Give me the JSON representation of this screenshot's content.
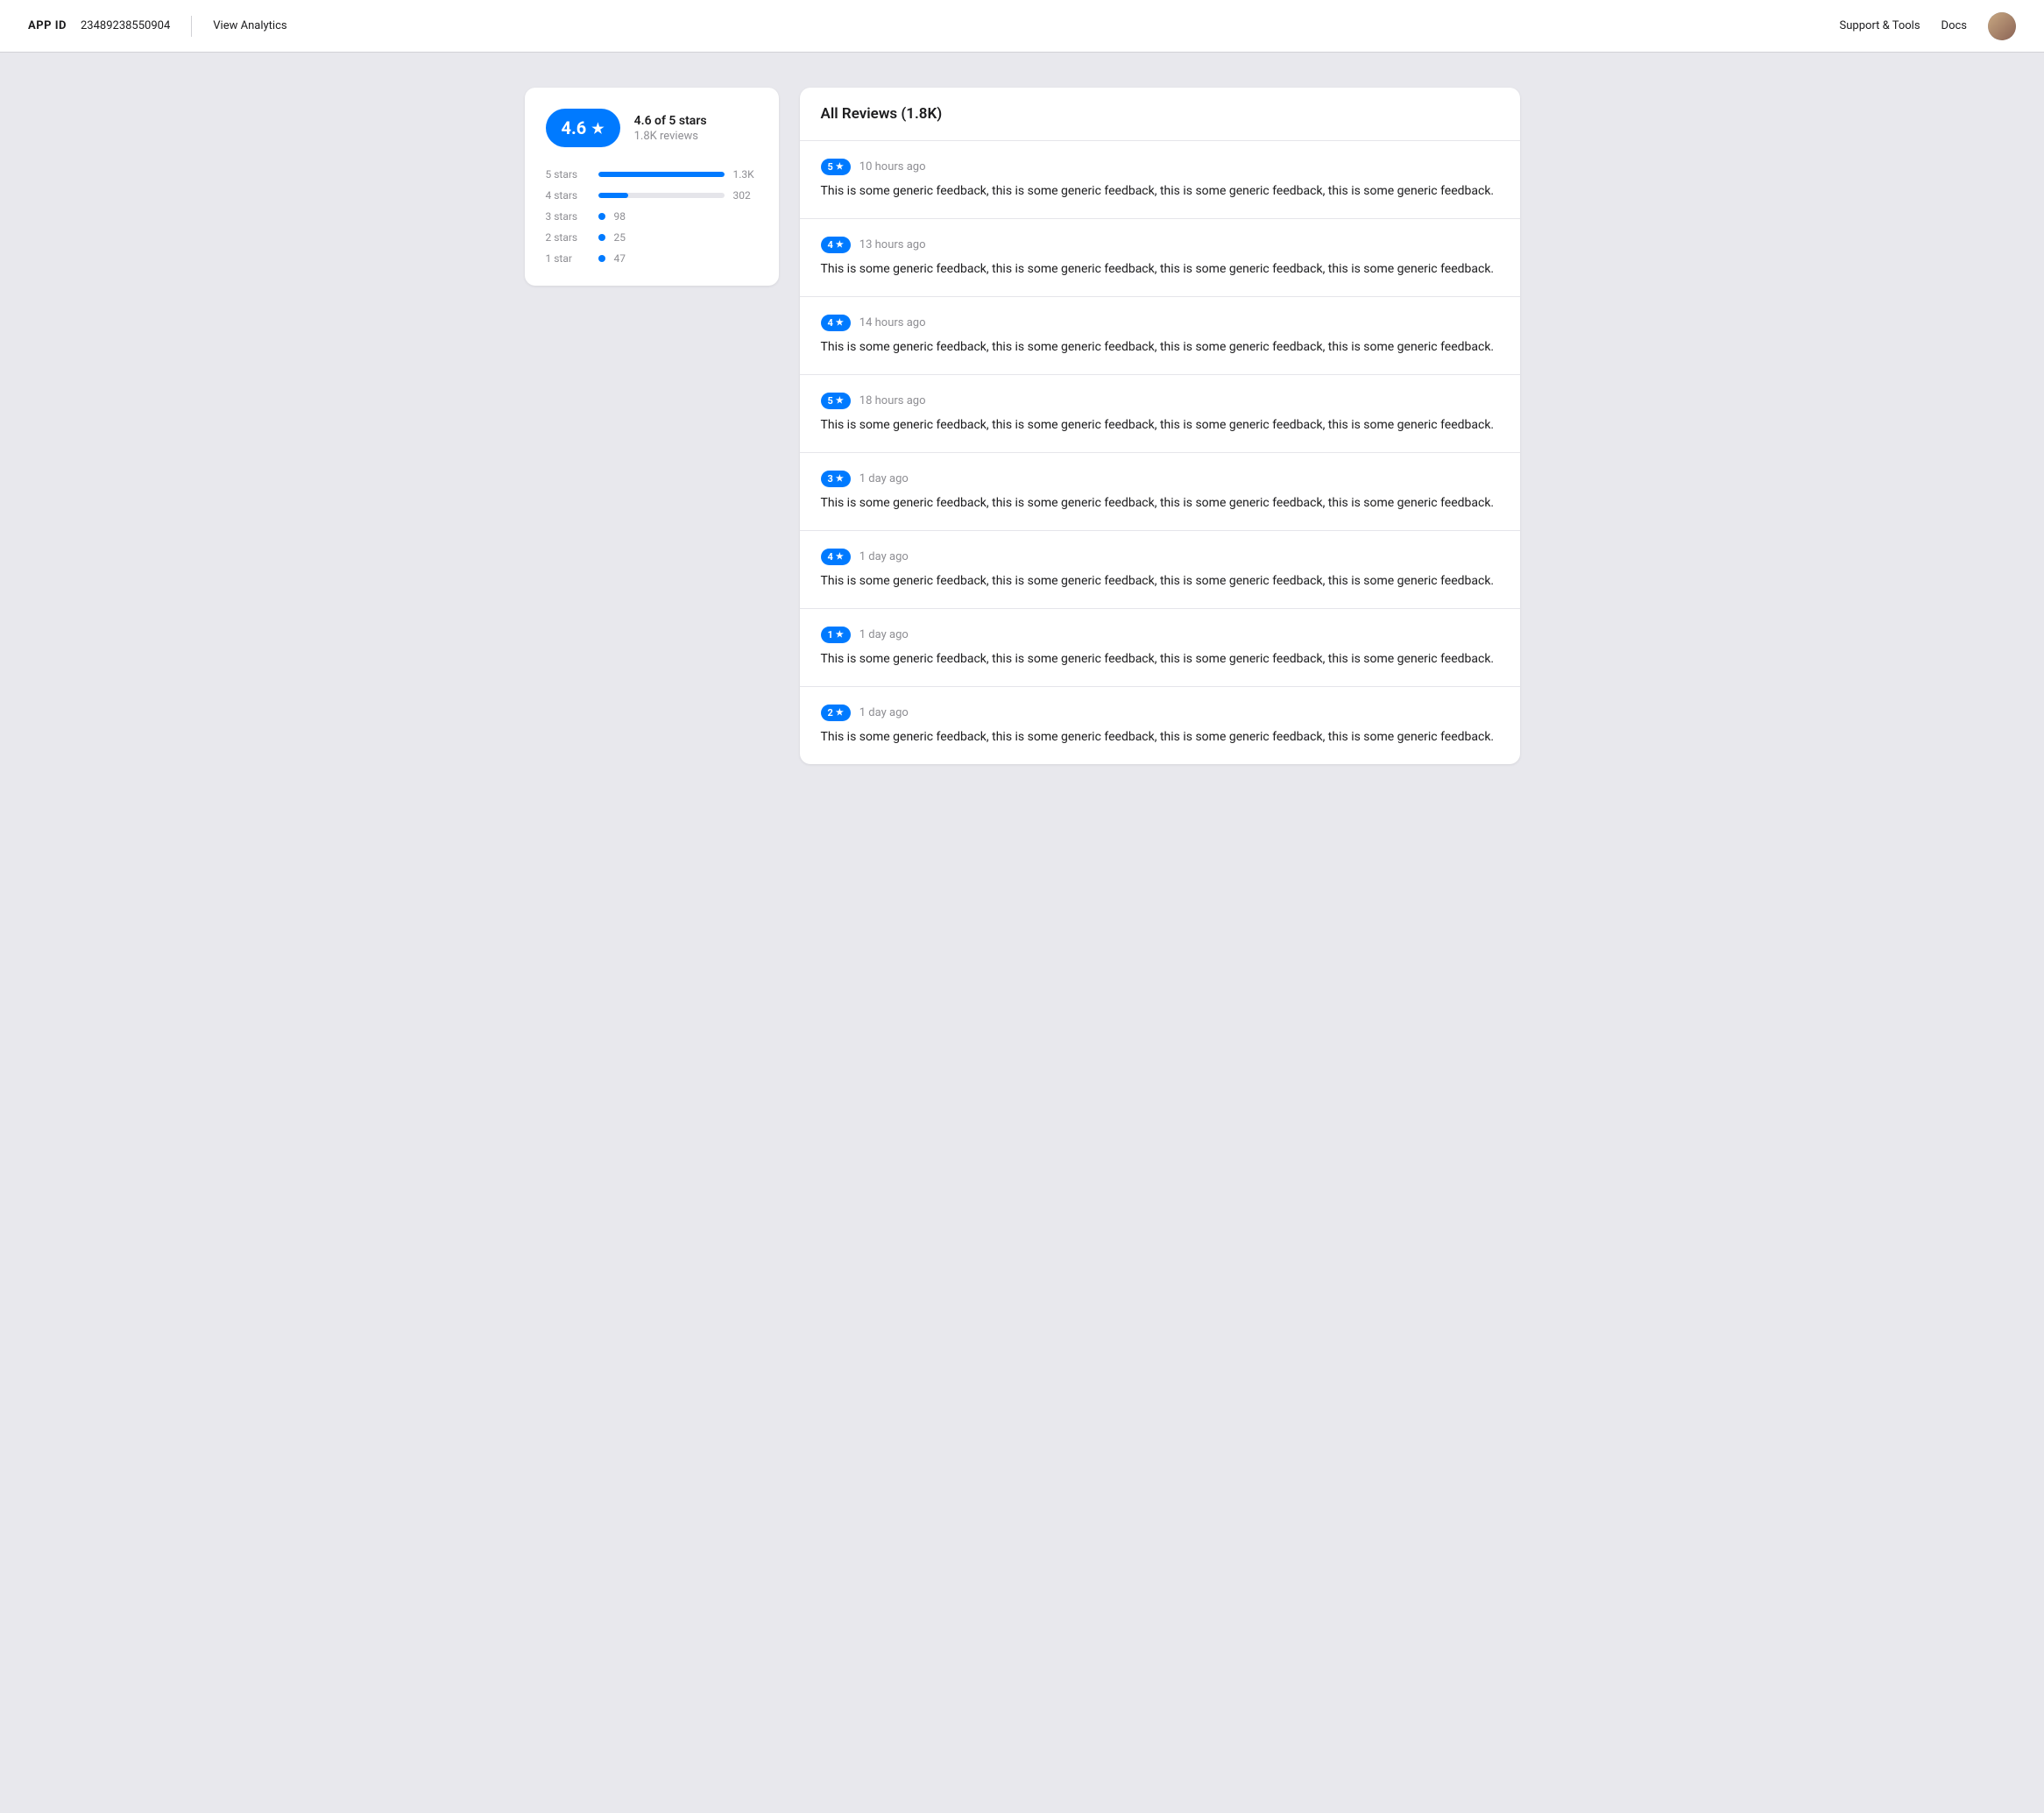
{
  "header": {
    "app_id_label": "APP ID",
    "app_id_value": "23489238550904",
    "view_analytics_label": "View Analytics",
    "support_tools_label": "Support & Tools",
    "docs_label": "Docs"
  },
  "rating_card": {
    "score": "4.6",
    "star_symbol": "★",
    "score_text": "4.6 of 5 stars",
    "review_count_text": "1.8K reviews",
    "bars": [
      {
        "label": "5 stars",
        "width_pct": 100,
        "count": "1.3K",
        "type": "bar"
      },
      {
        "label": "4 stars",
        "width_pct": 24,
        "count": "302",
        "type": "bar"
      },
      {
        "label": "3 stars",
        "width_pct": 6,
        "count": "98",
        "type": "dot"
      },
      {
        "label": "2 stars",
        "width_pct": 2,
        "count": "25",
        "type": "dot"
      },
      {
        "label": "1 star",
        "width_pct": 3,
        "count": "47",
        "type": "dot"
      }
    ]
  },
  "reviews": {
    "title": "All Reviews (1.8K)",
    "items": [
      {
        "stars": "5",
        "time": "10 hours ago",
        "text": "This is some generic feedback, this is some generic feedback, this is some generic feedback, this is some generic feedback."
      },
      {
        "stars": "4",
        "time": "13 hours ago",
        "text": "This is some generic feedback, this is some generic feedback, this is some generic feedback, this is some generic feedback."
      },
      {
        "stars": "4",
        "time": "14 hours ago",
        "text": "This is some generic feedback, this is some generic feedback, this is some generic feedback, this is some generic feedback."
      },
      {
        "stars": "5",
        "time": "18 hours ago",
        "text": "This is some generic feedback, this is some generic feedback, this is some generic feedback, this is some generic feedback."
      },
      {
        "stars": "3",
        "time": "1 day ago",
        "text": "This is some generic feedback, this is some generic feedback, this is some generic feedback, this is some generic feedback."
      },
      {
        "stars": "4",
        "time": "1 day ago",
        "text": "This is some generic feedback, this is some generic feedback, this is some generic feedback, this is some generic feedback."
      },
      {
        "stars": "1",
        "time": "1 day ago",
        "text": "This is some generic feedback, this is some generic feedback, this is some generic feedback, this is some generic feedback."
      },
      {
        "stars": "2",
        "time": "1 day ago",
        "text": "This is some generic feedback, this is some generic feedback, this is some generic feedback, this is some generic feedback."
      }
    ]
  },
  "colors": {
    "accent": "#007aff",
    "text_primary": "#1c1c1e",
    "text_secondary": "#8e8e93"
  }
}
